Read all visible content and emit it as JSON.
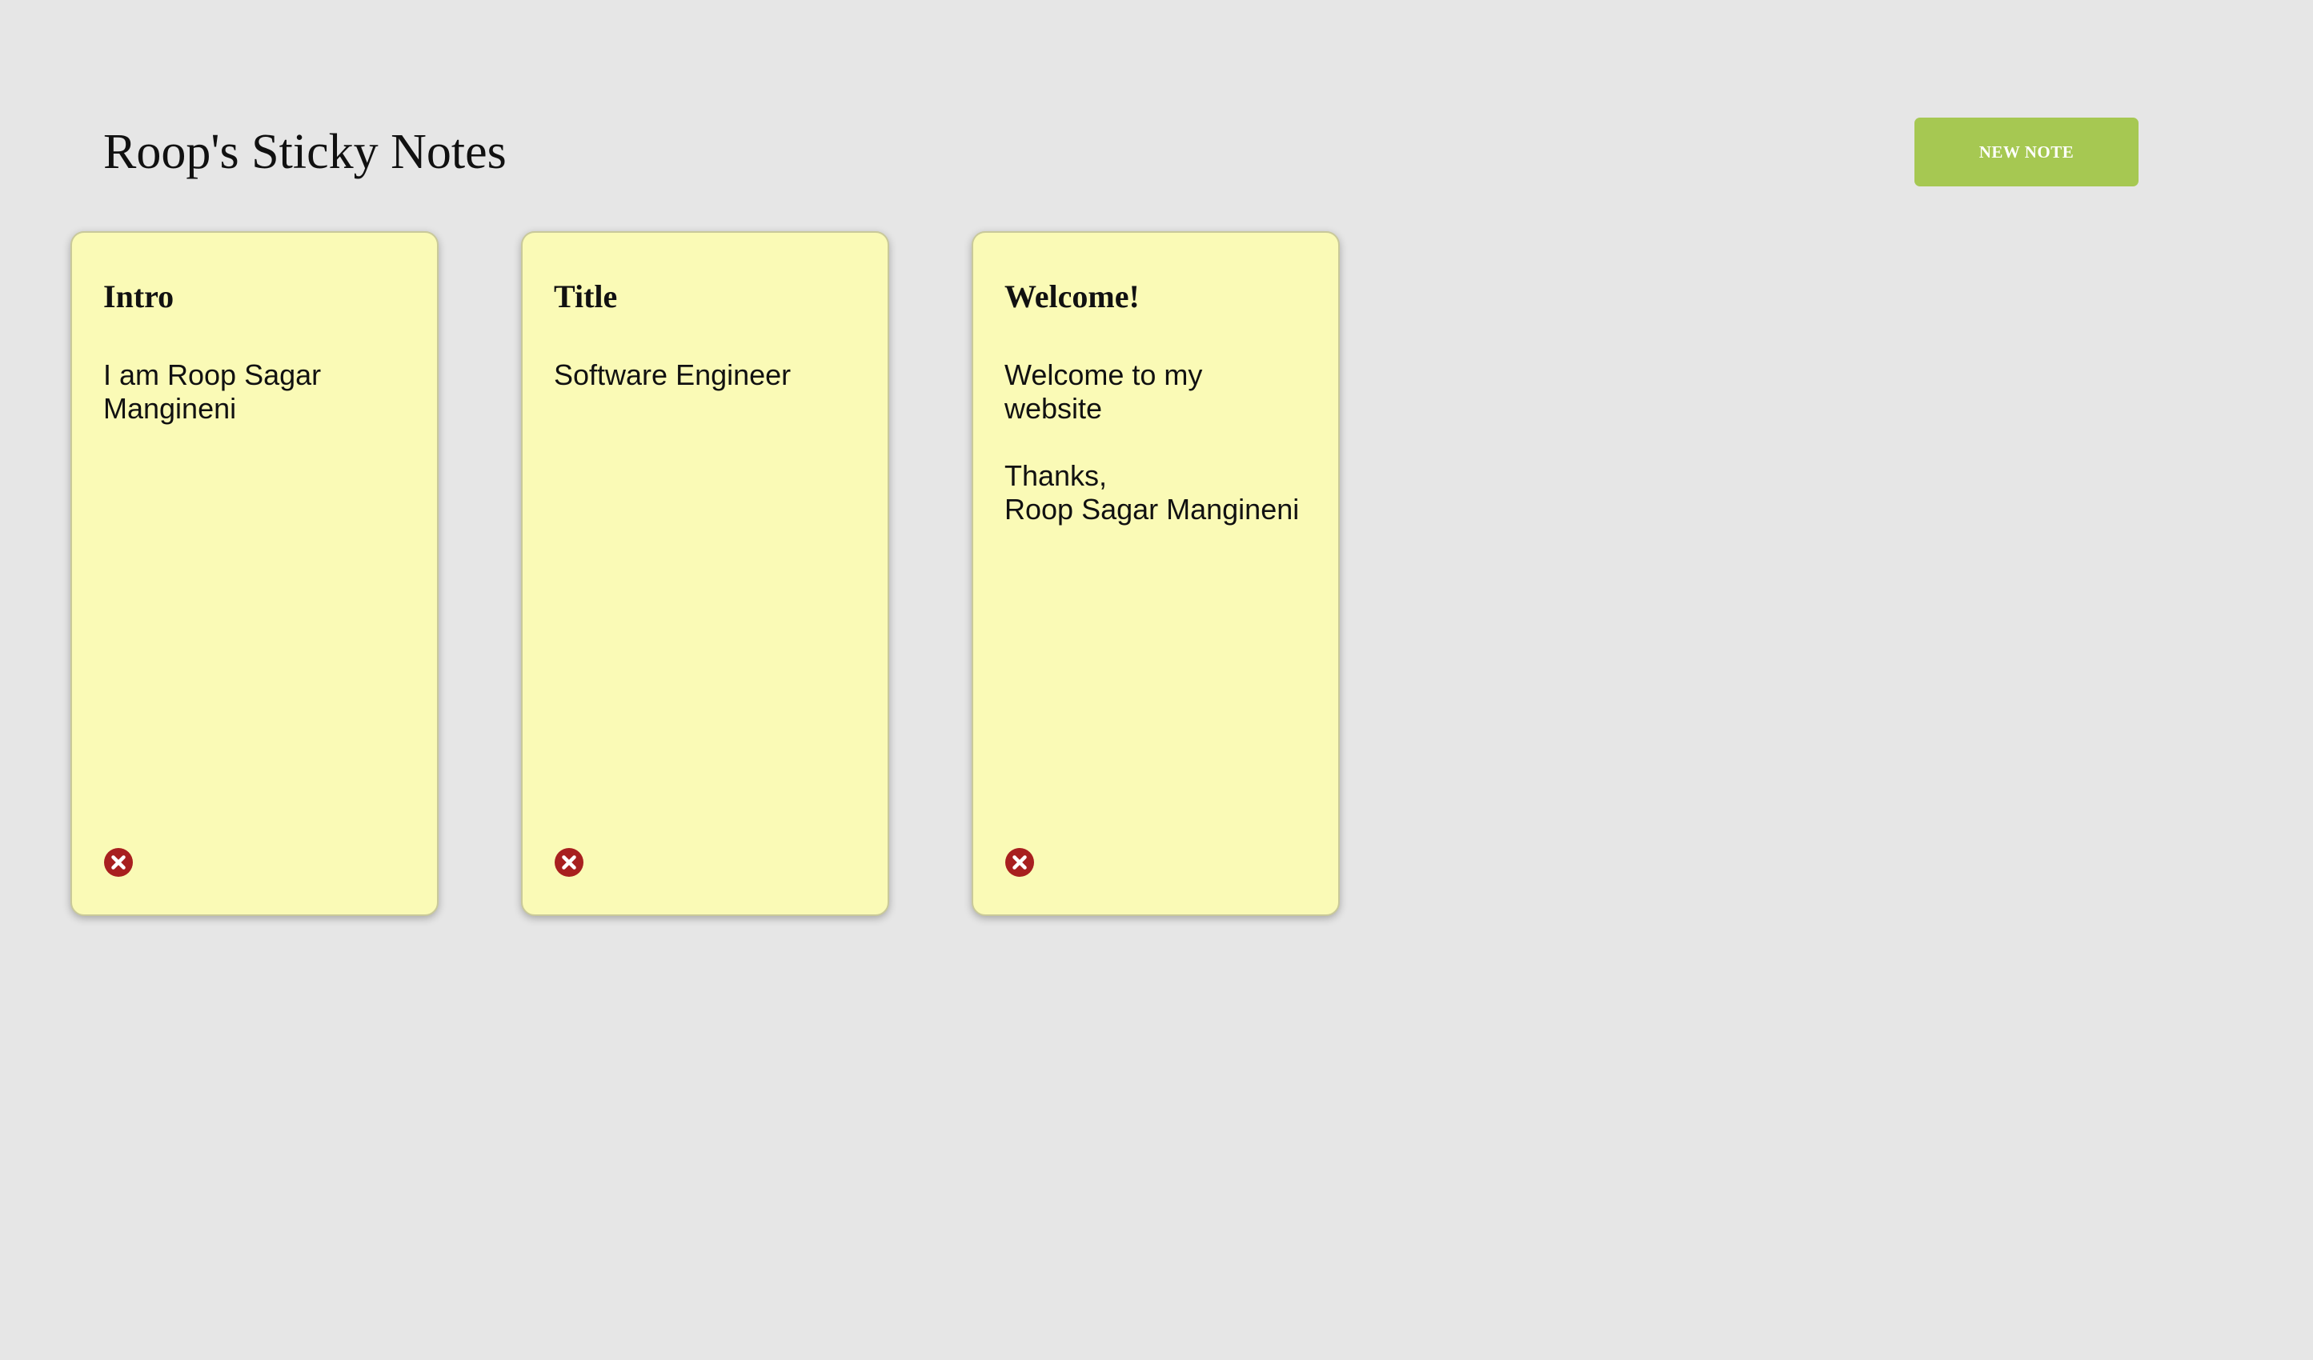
{
  "header": {
    "title": "Roop's Sticky Notes",
    "new_note_label": "NEW NOTE"
  },
  "notes": [
    {
      "title": "Intro",
      "body": "I am Roop Sagar\nMangineni"
    },
    {
      "title": "Title",
      "body": "Software Engineer"
    },
    {
      "title": "Welcome!",
      "body": "Welcome to my\nwebsite\n\nThanks,\nRoop Sagar Mangineni"
    }
  ],
  "colors": {
    "background": "#e6e6e6",
    "note": "#fafab6",
    "button": "#a6c852",
    "delete": "#a81f1f"
  },
  "icons": {
    "delete": "close-circle-icon"
  }
}
